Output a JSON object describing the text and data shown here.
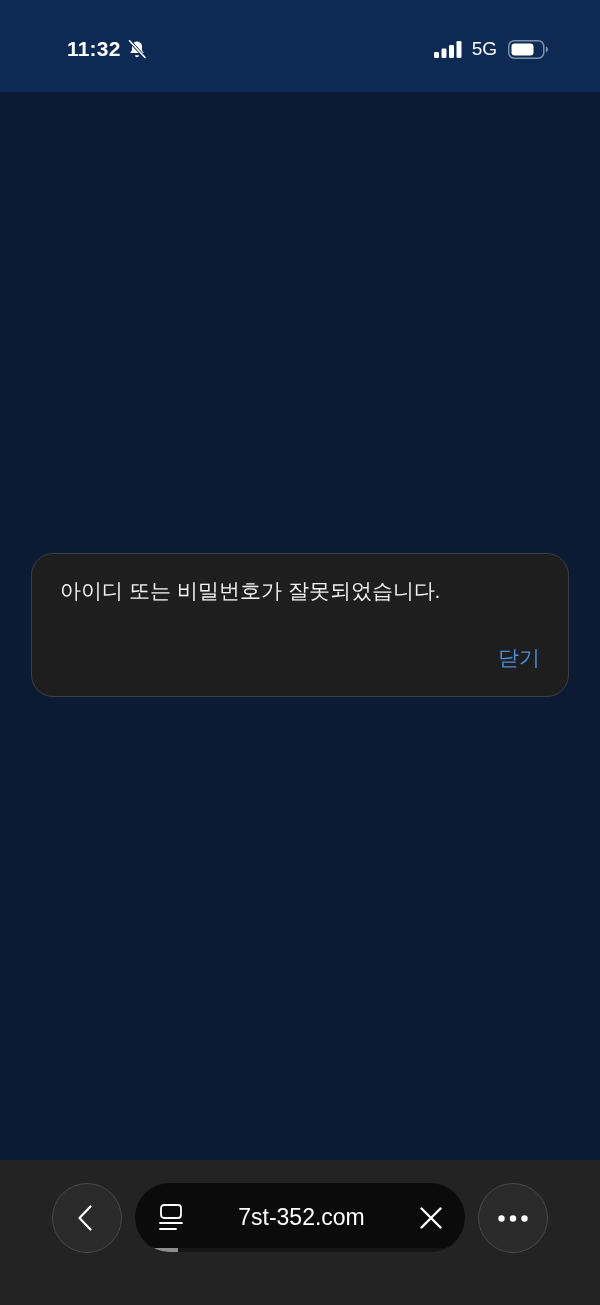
{
  "status_bar": {
    "time": "11:32",
    "silent": true,
    "network": "5G"
  },
  "dialog": {
    "message": "아이디 또는 비밀번호가 잘못되었습니다.",
    "buttons": [
      "닫기"
    ]
  },
  "browser_bar": {
    "url": "7st-352.com",
    "loading": {
      "level": 0.13
    }
  }
}
